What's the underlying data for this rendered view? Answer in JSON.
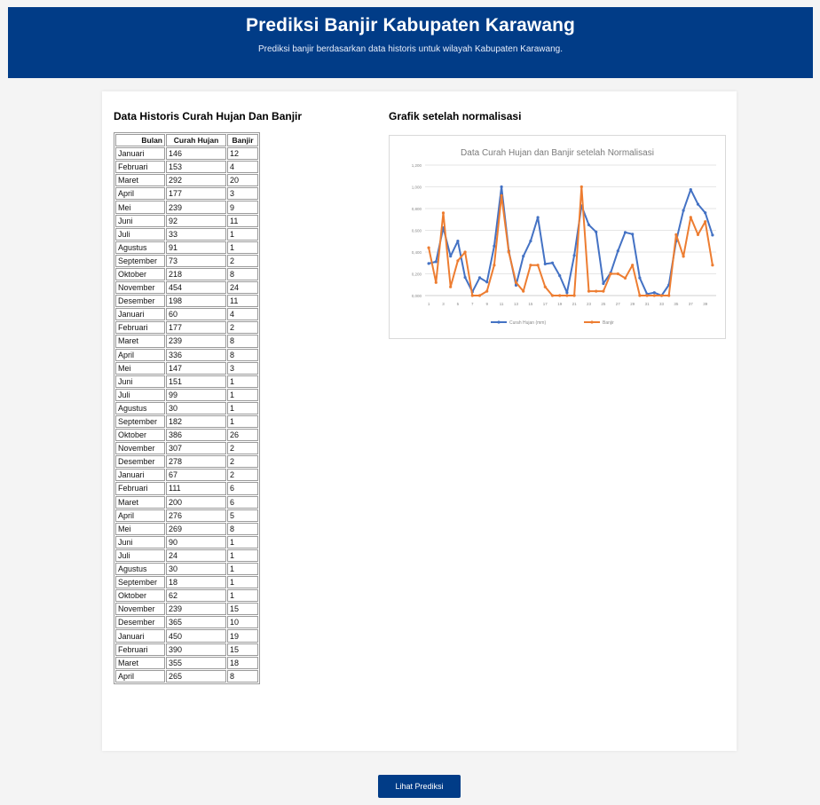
{
  "header": {
    "title": "Prediksi Banjir Kabupaten Karawang",
    "subtitle": "Prediksi banjir berdasarkan data historis untuk wilayah Kabupaten Karawang."
  },
  "table_section": {
    "title": "Data Historis Curah Hujan Dan Banjir",
    "columns": [
      "Bulan",
      "Curah Hujan",
      "Banjir"
    ],
    "rows": [
      [
        "Januari",
        "146",
        "12"
      ],
      [
        "Februari",
        "153",
        "4"
      ],
      [
        "Maret",
        "292",
        "20"
      ],
      [
        "April",
        "177",
        "3"
      ],
      [
        "Mei",
        "239",
        "9"
      ],
      [
        "Juni",
        "92",
        "11"
      ],
      [
        "Juli",
        "33",
        "1"
      ],
      [
        "Agustus",
        "91",
        "1"
      ],
      [
        "September",
        "73",
        "2"
      ],
      [
        "Oktober",
        "218",
        "8"
      ],
      [
        "November",
        "454",
        "24"
      ],
      [
        "Desember",
        "198",
        "11"
      ],
      [
        "Januari",
        "60",
        "4"
      ],
      [
        "Februari",
        "177",
        "2"
      ],
      [
        "Maret",
        "239",
        "8"
      ],
      [
        "April",
        "336",
        "8"
      ],
      [
        "Mei",
        "147",
        "3"
      ],
      [
        "Juni",
        "151",
        "1"
      ],
      [
        "Juli",
        "99",
        "1"
      ],
      [
        "Agustus",
        "30",
        "1"
      ],
      [
        "September",
        "182",
        "1"
      ],
      [
        "Oktober",
        "386",
        "26"
      ],
      [
        "November",
        "307",
        "2"
      ],
      [
        "Desember",
        "278",
        "2"
      ],
      [
        "Januari",
        "67",
        "2"
      ],
      [
        "Februari",
        "111",
        "6"
      ],
      [
        "Maret",
        "200",
        "6"
      ],
      [
        "April",
        "276",
        "5"
      ],
      [
        "Mei",
        "269",
        "8"
      ],
      [
        "Juni",
        "90",
        "1"
      ],
      [
        "Juli",
        "24",
        "1"
      ],
      [
        "Agustus",
        "30",
        "1"
      ],
      [
        "September",
        "18",
        "1"
      ],
      [
        "Oktober",
        "62",
        "1"
      ],
      [
        "November",
        "239",
        "15"
      ],
      [
        "Desember",
        "365",
        "10"
      ],
      [
        "Januari",
        "450",
        "19"
      ],
      [
        "Februari",
        "390",
        "15"
      ],
      [
        "Maret",
        "355",
        "18"
      ],
      [
        "April",
        "265",
        "8"
      ]
    ]
  },
  "chart_section": {
    "title": "Grafik setelah normalisasi"
  },
  "chart_data": {
    "type": "line",
    "title": "Data Curah Hujan dan Banjir setelah Normalisasi",
    "xlabel": "",
    "ylabel": "",
    "ylim": [
      0,
      1.2
    ],
    "yticks": [
      "0,000",
      "0,200",
      "0,400",
      "0,600",
      "0,800",
      "1,000",
      "1,200"
    ],
    "xticks": [
      "1",
      "3",
      "5",
      "7",
      "9",
      "11",
      "13",
      "15",
      "17",
      "19",
      "21",
      "23",
      "25",
      "27",
      "29",
      "31",
      "33",
      "35",
      "37",
      "39"
    ],
    "x": [
      1,
      2,
      3,
      4,
      5,
      6,
      7,
      8,
      9,
      10,
      11,
      12,
      13,
      14,
      15,
      16,
      17,
      18,
      19,
      20,
      21,
      22,
      23,
      24,
      25,
      26,
      27,
      28,
      29,
      30,
      31,
      32,
      33,
      34,
      35,
      36,
      37,
      38,
      39,
      40
    ],
    "series": [
      {
        "name": "Curah Hujan (mm)",
        "color": "#4472c4",
        "values": [
          0.295,
          0.311,
          0.624,
          0.362,
          0.501,
          0.167,
          0.034,
          0.164,
          0.124,
          0.455,
          1.0,
          0.41,
          0.095,
          0.362,
          0.501,
          0.719,
          0.291,
          0.3,
          0.183,
          0.027,
          0.369,
          0.826,
          0.65,
          0.585,
          0.11,
          0.209,
          0.41,
          0.581,
          0.565,
          0.162,
          0.014,
          0.027,
          0.0,
          0.098,
          0.501,
          0.783,
          0.975,
          0.84,
          0.761,
          0.556
        ]
      },
      {
        "name": "Banjir",
        "color": "#ed7d31",
        "values": [
          0.44,
          0.12,
          0.76,
          0.08,
          0.32,
          0.4,
          0.0,
          0.0,
          0.04,
          0.28,
          0.92,
          0.4,
          0.12,
          0.04,
          0.28,
          0.28,
          0.08,
          0.0,
          0.0,
          0.0,
          0.0,
          1.0,
          0.04,
          0.04,
          0.04,
          0.2,
          0.2,
          0.16,
          0.28,
          0.0,
          0.0,
          0.0,
          0.0,
          0.0,
          0.56,
          0.36,
          0.72,
          0.56,
          0.68,
          0.28
        ]
      }
    ],
    "legend": "bottom",
    "grid": true
  },
  "actions": {
    "predict_label": "Lihat Prediksi"
  }
}
